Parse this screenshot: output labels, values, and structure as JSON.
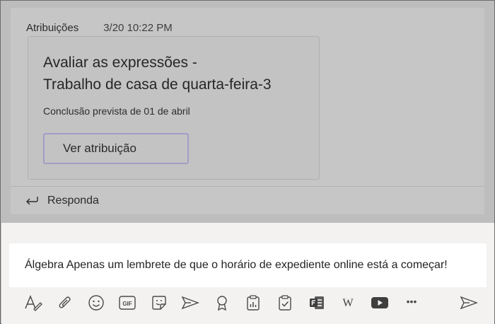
{
  "post": {
    "author": "Atribuições",
    "timestamp": "3/20 10:22 PM",
    "card": {
      "title_line1": "Avaliar as expressões -",
      "title_line2": "Trabalho de casa de quarta-feira-3",
      "due": "Conclusão prevista de 01 de abril",
      "button_label": "Ver atribuição"
    },
    "reply_label": "Responda"
  },
  "compose": {
    "text": "Álgebra Apenas um lembrete de que o horário de expediente online está a começar!"
  },
  "toolbar": {
    "icons": [
      "format-icon",
      "attach-icon",
      "emoji-icon",
      "gif-icon",
      "sticker-icon",
      "meet-icon",
      "praise-icon",
      "insights-icon",
      "assignments-icon",
      "forms-icon",
      "wikipedia-icon",
      "youtube-icon",
      "more-icon",
      "send-icon"
    ],
    "gif_text": "GIF",
    "wiki_text": "W",
    "more_text": "•••"
  },
  "colors": {
    "accent": "#6264a7",
    "compose_bg": "#f3f2f1",
    "overlay_bg": "#bdbdbd"
  }
}
